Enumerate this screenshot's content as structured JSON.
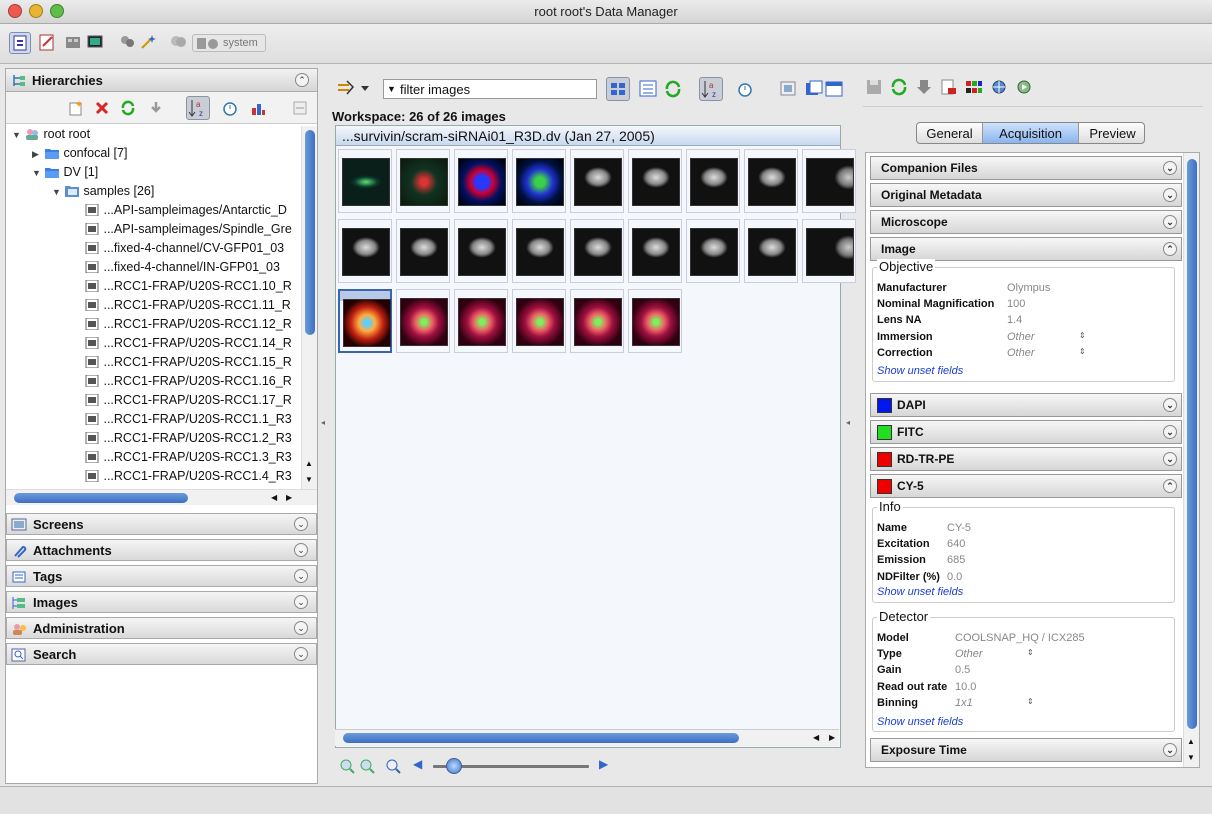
{
  "window": {
    "title": "root root's Data Manager"
  },
  "toolbar": {
    "group_label": "system"
  },
  "left": {
    "title": "Hierarchies",
    "tree": [
      {
        "label": "root root",
        "indent": 0,
        "twisty": "▼",
        "icon": "user-group-icon"
      },
      {
        "label": "confocal [7]",
        "indent": 1,
        "twisty": "▶",
        "icon": "folder-icon"
      },
      {
        "label": "DV [1]",
        "indent": 1,
        "twisty": "▼",
        "icon": "folder-icon"
      },
      {
        "label": "samples [26]",
        "indent": 2,
        "twisty": "▼",
        "icon": "dataset-icon"
      },
      {
        "label": "...API-sampleimages/Antarctic_D",
        "indent": 3,
        "twisty": "",
        "icon": "image-icon"
      },
      {
        "label": "...API-sampleimages/Spindle_Gre",
        "indent": 3,
        "twisty": "",
        "icon": "image-icon"
      },
      {
        "label": "...fixed-4-channel/CV-GFP01_03",
        "indent": 3,
        "twisty": "",
        "icon": "image-icon"
      },
      {
        "label": "...fixed-4-channel/IN-GFP01_03",
        "indent": 3,
        "twisty": "",
        "icon": "image-icon"
      },
      {
        "label": "...RCC1-FRAP/U20S-RCC1.10_R",
        "indent": 3,
        "twisty": "",
        "icon": "image-icon"
      },
      {
        "label": "...RCC1-FRAP/U20S-RCC1.11_R",
        "indent": 3,
        "twisty": "",
        "icon": "image-icon"
      },
      {
        "label": "...RCC1-FRAP/U20S-RCC1.12_R",
        "indent": 3,
        "twisty": "",
        "icon": "image-icon"
      },
      {
        "label": "...RCC1-FRAP/U20S-RCC1.14_R",
        "indent": 3,
        "twisty": "",
        "icon": "image-icon"
      },
      {
        "label": "...RCC1-FRAP/U20S-RCC1.15_R",
        "indent": 3,
        "twisty": "",
        "icon": "image-icon"
      },
      {
        "label": "...RCC1-FRAP/U20S-RCC1.16_R",
        "indent": 3,
        "twisty": "",
        "icon": "image-icon"
      },
      {
        "label": "...RCC1-FRAP/U20S-RCC1.17_R",
        "indent": 3,
        "twisty": "",
        "icon": "image-icon"
      },
      {
        "label": "...RCC1-FRAP/U20S-RCC1.1_R3",
        "indent": 3,
        "twisty": "",
        "icon": "image-icon"
      },
      {
        "label": "...RCC1-FRAP/U20S-RCC1.2_R3",
        "indent": 3,
        "twisty": "",
        "icon": "image-icon"
      },
      {
        "label": "...RCC1-FRAP/U20S-RCC1.3_R3",
        "indent": 3,
        "twisty": "",
        "icon": "image-icon"
      },
      {
        "label": "...RCC1-FRAP/U20S-RCC1.4_R3",
        "indent": 3,
        "twisty": "",
        "icon": "image-icon"
      }
    ],
    "accordion": [
      {
        "label": "Screens",
        "icon": "screen-icon"
      },
      {
        "label": "Attachments",
        "icon": "paperclip-icon"
      },
      {
        "label": "Tags",
        "icon": "tag-icon"
      },
      {
        "label": "Images",
        "icon": "image-list-icon"
      },
      {
        "label": "Administration",
        "icon": "admin-icon"
      },
      {
        "label": "Search",
        "icon": "search-icon"
      }
    ]
  },
  "center": {
    "filter_value": "filter  images",
    "workspace_label": "Workspace: 26 of 26 images",
    "browser_title": "...survivin/scram-siRNAi01_R3D.dv (Jan 27, 2005)",
    "thumbnails": [
      {
        "kind": "green-cell"
      },
      {
        "kind": "red-green"
      },
      {
        "kind": "blue-red"
      },
      {
        "kind": "blue-green"
      },
      {
        "kind": "gray"
      },
      {
        "kind": "gray"
      },
      {
        "kind": "gray"
      },
      {
        "kind": "gray"
      },
      {
        "kind": "gray-partial"
      },
      {
        "kind": "gray"
      },
      {
        "kind": "gray"
      },
      {
        "kind": "gray"
      },
      {
        "kind": "gray"
      },
      {
        "kind": "gray"
      },
      {
        "kind": "gray"
      },
      {
        "kind": "gray"
      },
      {
        "kind": "gray"
      },
      {
        "kind": "gray-partial"
      },
      {
        "kind": "red-selected"
      },
      {
        "kind": "red"
      },
      {
        "kind": "red"
      },
      {
        "kind": "red"
      },
      {
        "kind": "red"
      },
      {
        "kind": "red"
      }
    ],
    "selected_index": 18
  },
  "right": {
    "tabs": [
      {
        "label": "General",
        "active": false
      },
      {
        "label": "Acquisition",
        "active": true
      },
      {
        "label": "Preview",
        "active": false
      }
    ],
    "sections": {
      "companion": "Companion Files",
      "original": "Original Metadata",
      "microscope": "Microscope",
      "image": "Image",
      "dapi": "DAPI",
      "fitc": "FITC",
      "rdtrpe": "RD-TR-PE",
      "cy5": "CY-5",
      "exposure": "Exposure Time"
    },
    "channel_colors": {
      "dapi": "#0018ee",
      "fitc": "#22dd22",
      "rdtrpe": "#ee0000",
      "cy5": "#ee0000"
    },
    "objective": {
      "title": "Objective",
      "rows": [
        {
          "k": "Manufacturer",
          "v": "Olympus",
          "italic": false
        },
        {
          "k": "Nominal Magnification",
          "v": "100",
          "italic": false
        },
        {
          "k": "Lens NA",
          "v": "1.4",
          "italic": false
        },
        {
          "k": "Immersion",
          "v": "Other",
          "italic": true
        },
        {
          "k": "Correction",
          "v": "Other",
          "italic": true
        }
      ],
      "unset": "Show unset fields"
    },
    "info": {
      "title": "Info",
      "rows": [
        {
          "k": "Name",
          "v": "CY-5",
          "italic": false
        },
        {
          "k": "Excitation",
          "v": "640",
          "italic": false
        },
        {
          "k": "Emission",
          "v": "685",
          "italic": false
        },
        {
          "k": "NDFilter (%)",
          "v": "0.0",
          "italic": false
        }
      ],
      "unset": "Show unset fields"
    },
    "detector": {
      "title": "Detector",
      "rows": [
        {
          "k": "Model",
          "v": "COOLSNAP_HQ / ICX285",
          "italic": false
        },
        {
          "k": "Type",
          "v": "Other",
          "italic": true
        },
        {
          "k": "Gain",
          "v": "0.5",
          "italic": false
        },
        {
          "k": "Read out rate",
          "v": "10.0",
          "italic": false
        },
        {
          "k": "Binning",
          "v": "1x1",
          "italic": true
        }
      ],
      "unset": "Show unset fields"
    }
  }
}
